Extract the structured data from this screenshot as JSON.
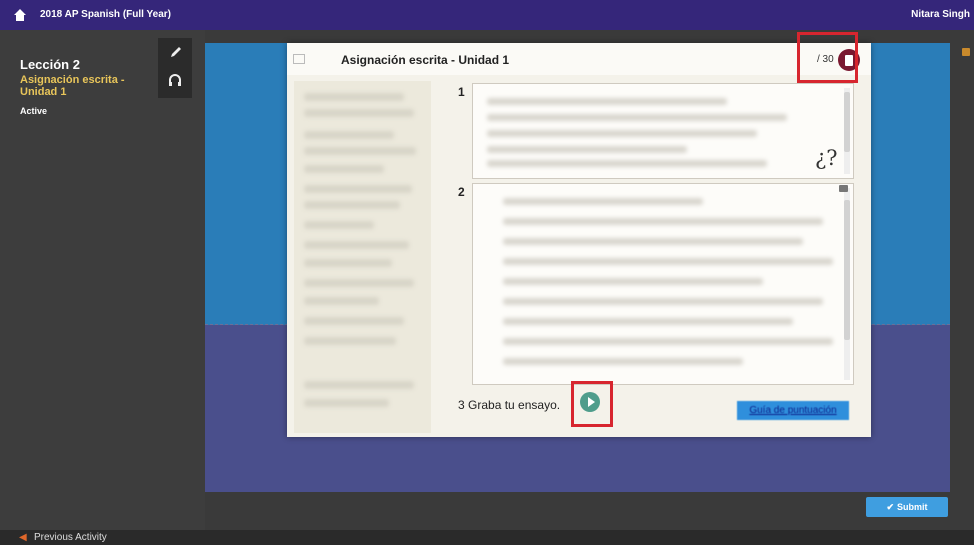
{
  "topbar": {
    "course_title": "2018 AP Spanish (Full Year)",
    "user_name": "Nitara Singh"
  },
  "sidebar": {
    "lesson_title": "Lección 2",
    "activity_name": "Asignación escrita - Unidad 1",
    "activity_status": "Active",
    "tools": [
      "pencil-icon",
      "headphone-icon"
    ]
  },
  "modal": {
    "title": "Asignación escrita - Unidad 1",
    "score_label": "/ 30",
    "questions": [
      {
        "number": "1",
        "help": "¿?"
      },
      {
        "number": "2"
      },
      {
        "number": "3",
        "text": "Graba tu ensayo."
      }
    ],
    "rubric_link": "Guía de puntuación"
  },
  "footer": {
    "submit_label": "Submit",
    "previous_label": "Previous Activity"
  },
  "colors": {
    "topbar": "#35267a",
    "stage_top": "#2a7db8",
    "stage_bottom": "#4a4f8c",
    "activity_name": "#e8c55a",
    "score_icon": "#7a1830",
    "record_button": "#4f9d8c",
    "highlight": "#d7262f",
    "submit": "#3f9ee0"
  }
}
